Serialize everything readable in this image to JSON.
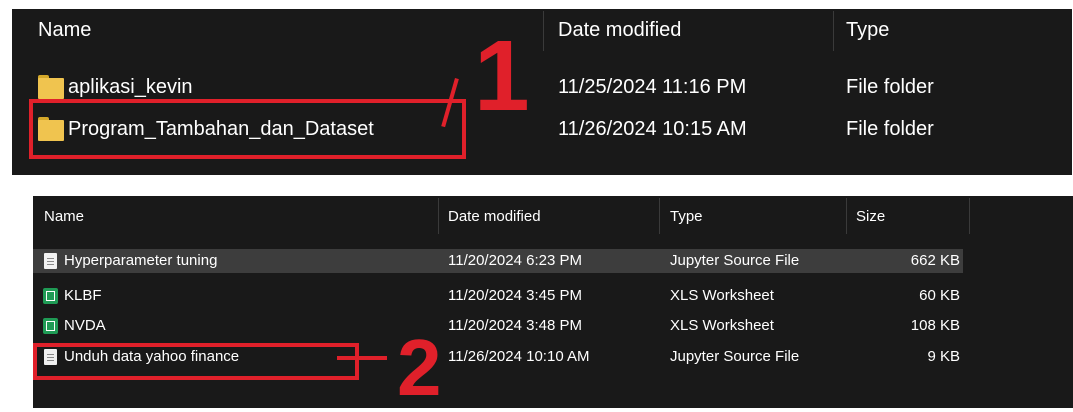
{
  "top_view": {
    "columns": [
      "Name",
      "Date modified",
      "Type"
    ],
    "rows": [
      {
        "name": "aplikasi_kevin",
        "date": "11/25/2024 11:16 PM",
        "type": "File folder"
      },
      {
        "name": "Program_Tambahan_dan_Dataset",
        "date": "11/26/2024 10:15 AM",
        "type": "File folder"
      }
    ]
  },
  "bottom_view": {
    "columns": [
      "Name",
      "Date modified",
      "Type",
      "Size"
    ],
    "rows": [
      {
        "name": "Hyperparameter tuning",
        "date": "11/20/2024 6:23 PM",
        "type": "Jupyter Source File",
        "size": "662 KB",
        "icon": "file-icon"
      },
      {
        "name": "KLBF",
        "date": "11/20/2024 3:45 PM",
        "type": "XLS Worksheet",
        "size": "60 KB",
        "icon": "xls-icon"
      },
      {
        "name": "NVDA",
        "date": "11/20/2024 3:48 PM",
        "type": "XLS Worksheet",
        "size": "108 KB",
        "icon": "xls-icon"
      },
      {
        "name": "Unduh data yahoo finance",
        "date": "11/26/2024 10:10 AM",
        "type": "Jupyter Source File",
        "size": "9 KB",
        "icon": "file-icon"
      }
    ]
  },
  "annotations": {
    "one": "1",
    "two": "2"
  },
  "colors": {
    "annotation": "#e0202a",
    "background": "#191919",
    "selected": "#3d3d3d"
  }
}
